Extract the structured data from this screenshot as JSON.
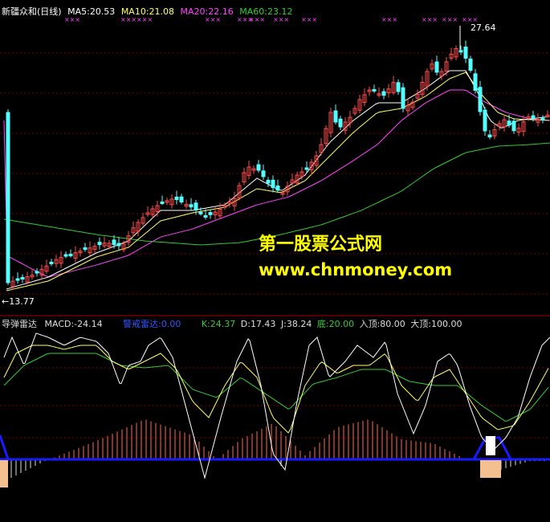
{
  "colors": {
    "background": "#000000",
    "up": "#ff4a4a",
    "down": "#54ffff",
    "ma5": "#ffffff",
    "ma10": "#ffff66",
    "ma20": "#ff44ff",
    "ma60": "#33cc33",
    "grid": "#7a0000",
    "watermark": "#ffff00",
    "blue_line": "#1a1aff",
    "k_line": "#ffffff",
    "d_line": "#ffff66",
    "j_line": "#33cc33",
    "macd_bar": "#ff6a4a",
    "box_fill": "#f4c090"
  },
  "header": {
    "stock": "新疆众和(日线)",
    "ma5": "MA5:20.53",
    "ma10": "MA10:21.08",
    "ma20": "MA20:22.16",
    "ma60": "MA60:23.12"
  },
  "indicator_header": {
    "name": "导弹雷达",
    "macd": "MACD:-24.14",
    "alert": "警戒雷达:0.00",
    "k": "K:24.37",
    "d": "D:17.43",
    "j": "J:38.24",
    "bottom": "底:20.00",
    "top_in": "入顶:80.00",
    "top_big": "大顶:100.00"
  },
  "watermark": {
    "line1": "第一股票公式网",
    "line2": "www.chnmoney.com"
  },
  "price_labels": {
    "high": "27.64",
    "low": "13.77"
  },
  "chart_data": {
    "type": "candlestick",
    "high_price": 27.64,
    "low_price": 13.77,
    "moving_averages": [
      "MA5",
      "MA10",
      "MA20",
      "MA60"
    ],
    "indicator": "导弹雷达",
    "oscillator_levels": [
      20,
      80,
      100
    ]
  }
}
